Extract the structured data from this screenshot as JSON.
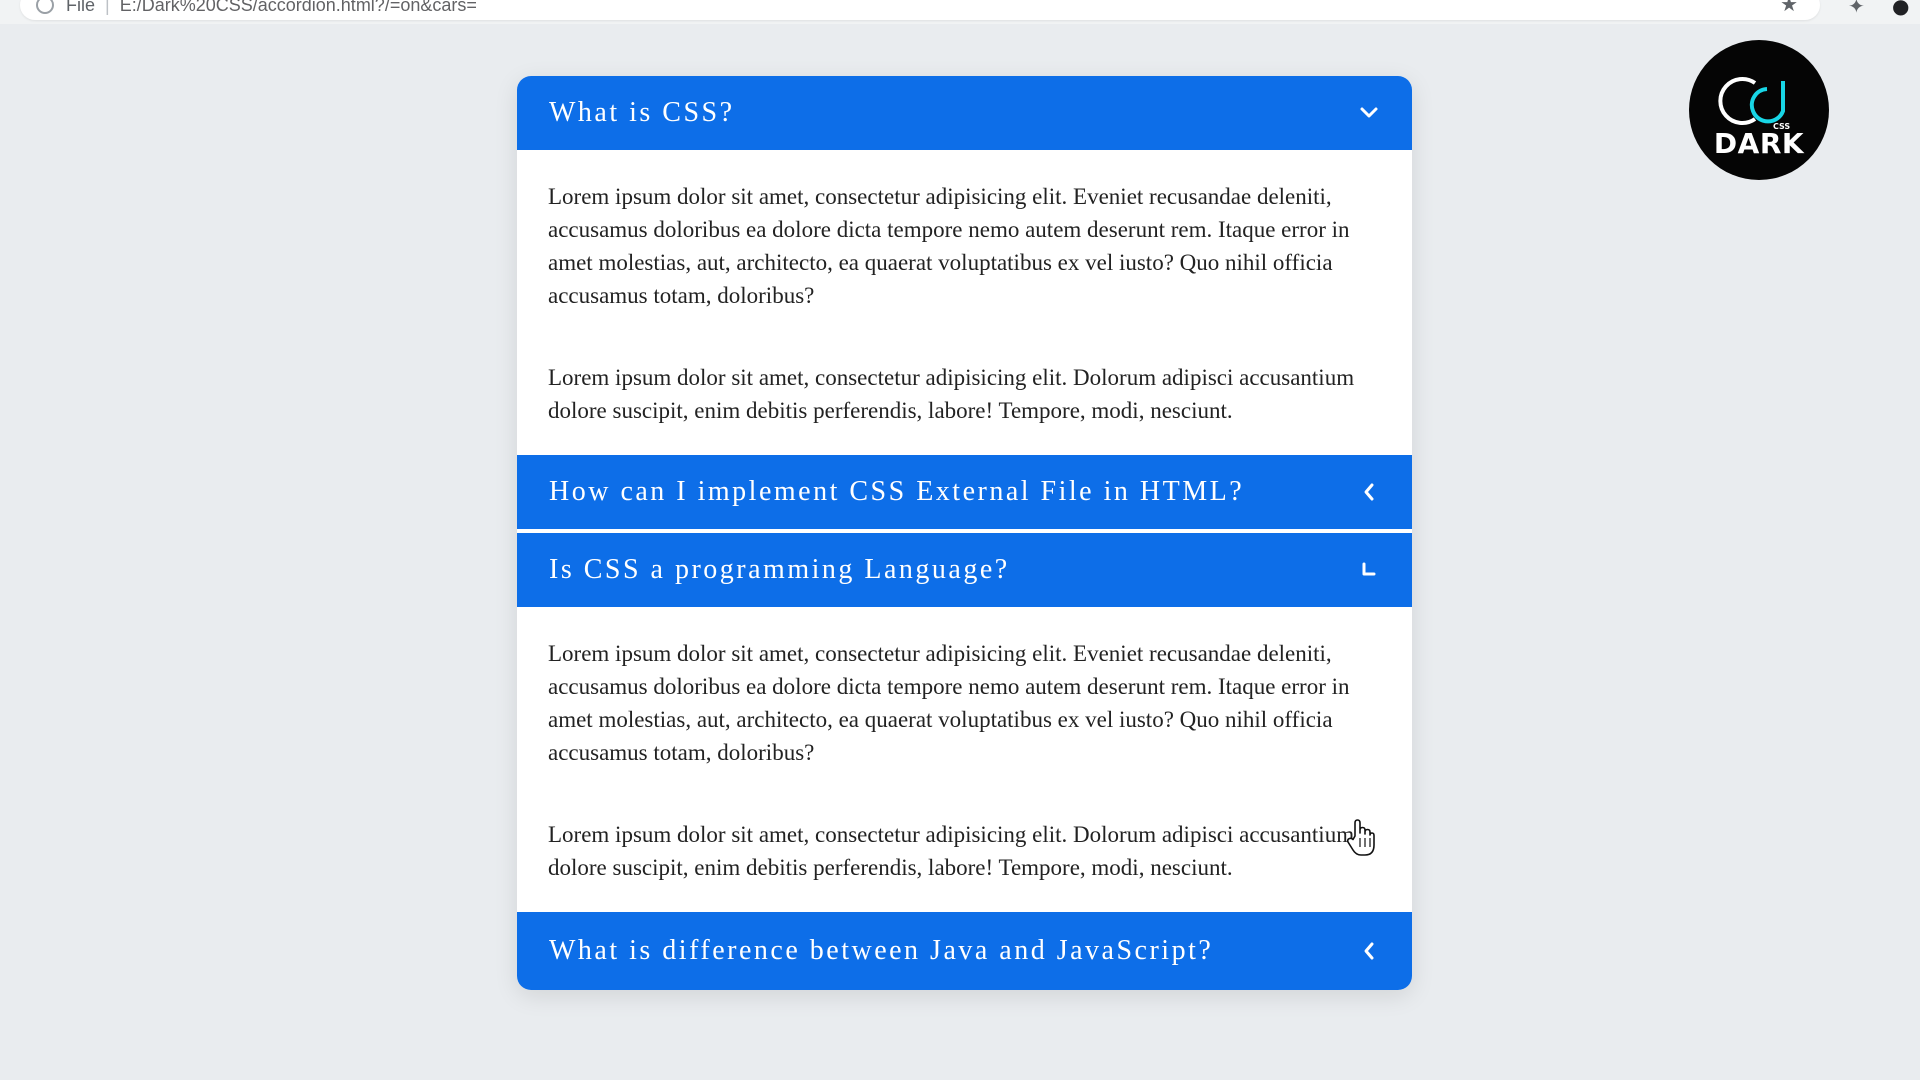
{
  "browser": {
    "file_label": "File",
    "url": "E:/Dark%20CSS/accordion.html?/=on&cars="
  },
  "accordion": {
    "items": [
      {
        "title": "What is CSS?",
        "state": "open",
        "paragraphs": [
          "Lorem ipsum dolor sit amet, consectetur adipisicing elit. Eveniet recusandae deleniti, accusamus doloribus ea dolore dicta tempore nemo autem deserunt rem. Itaque error in amet molestias, aut, architecto, ea quaerat voluptatibus ex vel iusto? Quo nihil officia accusamus totam, doloribus?",
          "Lorem ipsum dolor sit amet, consectetur adipisicing elit. Dolorum adipisci accusantium dolore suscipit, enim debitis perferendis, labore! Tempore, modi, nesciunt."
        ]
      },
      {
        "title": "How can I implement CSS External File in HTML?",
        "state": "closed"
      },
      {
        "title": "Is CSS a programming Language?",
        "state": "open",
        "paragraphs": [
          "Lorem ipsum dolor sit amet, consectetur adipisicing elit. Eveniet recusandae deleniti, accusamus doloribus ea dolore dicta tempore nemo autem deserunt rem. Itaque error in amet molestias, aut, architecto, ea quaerat voluptatibus ex vel iusto? Quo nihil officia accusamus totam, doloribus?",
          "Lorem ipsum dolor sit amet, consectetur adipisicing elit. Dolorum adipisci accusantium dolore suscipit, enim debitis perferendis, labore! Tempore, modi, nesciunt."
        ]
      },
      {
        "title": "What is difference between Java and JavaScript?",
        "state": "closed"
      }
    ]
  },
  "logo": {
    "text": "DARK",
    "subtext": "CSS"
  },
  "colors": {
    "accent": "#0d6ee8",
    "page_background": "#e9ecef",
    "panel_background": "#ffffff",
    "body_text": "#222222"
  },
  "icons": {
    "open": "chevron-down-icon",
    "closed": "chevron-left-icon",
    "browser_info": "info-icon",
    "bookmark": "star-icon",
    "pointer": "hand-cursor-icon"
  }
}
